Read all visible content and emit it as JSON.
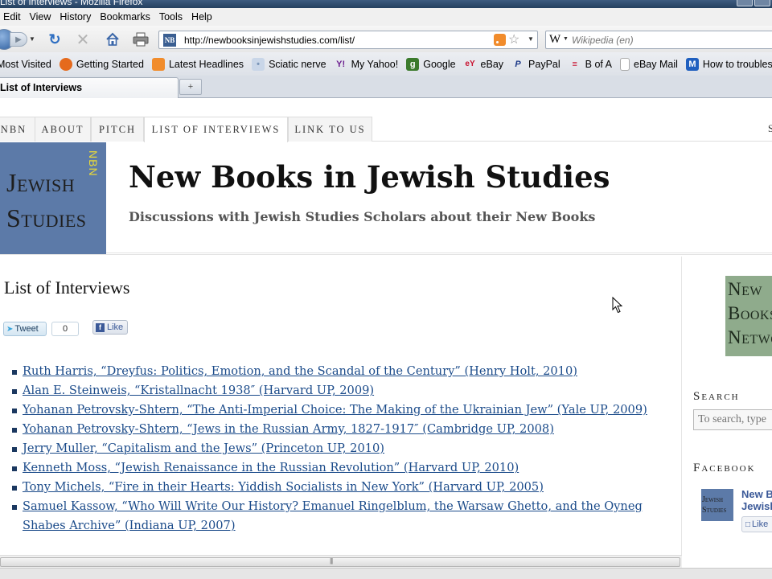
{
  "window": {
    "title": "List of Interviews - Mozilla Firefox"
  },
  "menu": {
    "items": [
      "Edit",
      "View",
      "History",
      "Bookmarks",
      "Tools",
      "Help"
    ]
  },
  "nav": {
    "url": "http://newbooksinjewishstudies.com/list/",
    "search_placeholder": "Wikipedia (en)",
    "search_engine": "W"
  },
  "bookmarks": [
    {
      "label": "Most Visited",
      "icon": "gear-icon",
      "color": "#4a73b5"
    },
    {
      "label": "Getting Started",
      "icon": "firefox-icon",
      "color": "#e56a1d"
    },
    {
      "label": "Latest Headlines",
      "icon": "rss-icon",
      "color": "#f18c2c"
    },
    {
      "label": "Sciatic nerve",
      "icon": "web-icon",
      "color": "#7a95b8"
    },
    {
      "label": "My Yahoo!",
      "icon": "yahoo-icon",
      "color": "#6b1f8f"
    },
    {
      "label": "Google",
      "icon": "google-icon",
      "color": "#3b7a2c"
    },
    {
      "label": "eBay",
      "icon": "ebay-icon",
      "color": "#c8102e"
    },
    {
      "label": "PayPal",
      "icon": "paypal-icon",
      "color": "#1f3c8a"
    },
    {
      "label": "B of A",
      "icon": "bofa-icon",
      "color": "#c8102e"
    },
    {
      "label": "eBay Mail",
      "icon": "page-icon",
      "color": "#ffffff"
    },
    {
      "label": "How to troubleshoot s...",
      "icon": "microsoft-icon",
      "color": "#1f5fbf"
    }
  ],
  "tabs": [
    {
      "label": "List of Interviews",
      "active": true
    }
  ],
  "site": {
    "nav_items": [
      "NBN",
      "ABOUT",
      "PITCH",
      "LIST OF INTERVIEWS",
      "LINK TO US"
    ],
    "nav_right": "S",
    "logo_lines": [
      "Jewish",
      "Studies"
    ],
    "logo_badge": "NBN",
    "title": "New Books in Jewish Studies",
    "subtitle": "Discussions with Jewish Studies Scholars about their New Books"
  },
  "main": {
    "heading": "List of Interviews",
    "tweet_label": "Tweet",
    "tweet_count": "0",
    "like_label": "Like",
    "interviews": [
      "Ruth Harris, “Dreyfus: Politics, Emotion, and the Scandal of the Century” (Henry Holt, 2010)",
      "Alan E. Steinweis, “Kristallnacht 1938″ (Harvard UP, 2009)",
      "Yohanan Petrovsky-Shtern, “The Anti-Imperial Choice: The Making of the Ukrainian Jew” (Yale UP, 2009)",
      "Yohanan Petrovsky-Shtern, “Jews in the Russian Army, 1827-1917″ (Cambridge UP, 2008)",
      "Jerry Muller, “Capitalism and the Jews” (Princeton UP, 2010)",
      "Kenneth Moss, “Jewish Renaissance in the Russian Revolution” (Harvard UP, 2010)",
      "Tony Michels, “Fire in their Hearts: Yiddish Socialists in New York” (Harvard UP, 2005)",
      "Samuel Kassow, “Who Will Write Our History? Emanuel Ringelblum, the Warsaw Ghetto, and the Oyneg Shabes Archive” (Indiana UP, 2007)"
    ]
  },
  "sidebar": {
    "network_logo_lines": [
      "New",
      "Books",
      "Network"
    ],
    "search_label": "Search",
    "search_placeholder": "To search, type",
    "facebook_label": "Facebook",
    "fb_thumb_lines": [
      "Jewish",
      "Studies"
    ],
    "fb_page_name_lines": [
      "New B",
      "Jewish"
    ],
    "fb_like_label": "Like"
  },
  "colors": {
    "logo_blue": "#5c7aa8",
    "logo_yellow": "#e8d83a",
    "network_green": "#8fab8c",
    "link_blue": "#1b4b8a"
  }
}
